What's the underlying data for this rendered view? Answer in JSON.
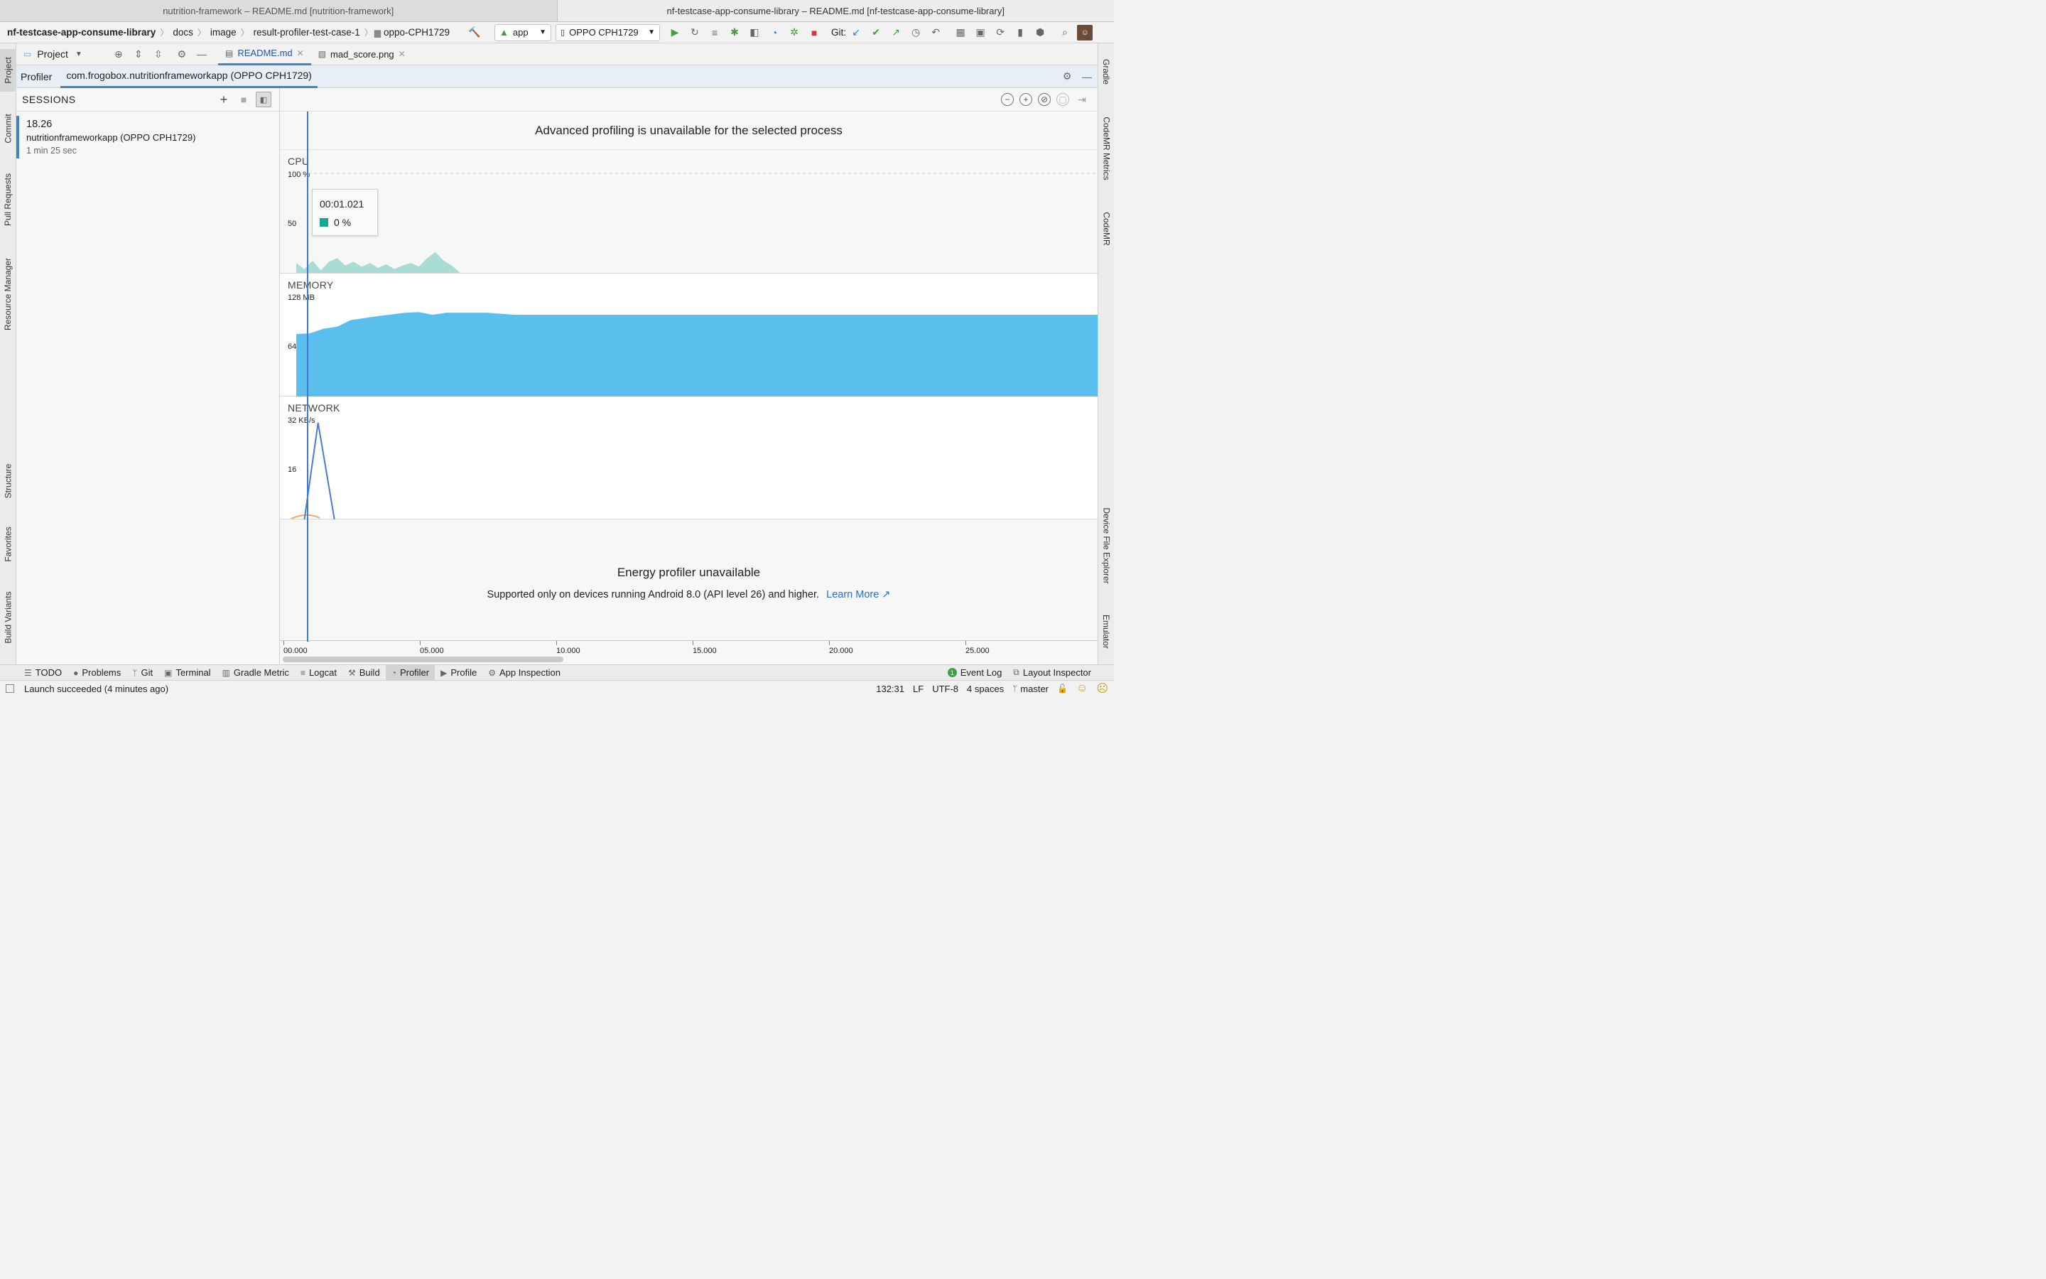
{
  "window_tabs": [
    {
      "label": "nutrition-framework – README.md [nutrition-framework]"
    },
    {
      "label": "nf-testcase-app-consume-library – README.md [nf-testcase-app-consume-library]"
    }
  ],
  "breadcrumbs": [
    "nf-testcase-app-consume-library",
    "docs",
    "image",
    "result-profiler-test-case-1",
    "oppo-CPH1729"
  ],
  "toolbar": {
    "run_config": "app",
    "device": "OPPO CPH1729",
    "git_label": "Git:"
  },
  "project_panel": {
    "title": "Project"
  },
  "editor_tabs": [
    {
      "label": "README.md",
      "active": true
    },
    {
      "label": "mad_score.png",
      "active": false
    }
  ],
  "left_tools": [
    "Project",
    "Commit",
    "Pull Requests",
    "Resource Manager",
    "Structure",
    "Favorites",
    "Build Variants"
  ],
  "right_tools": [
    "Gradle",
    "CodeMR Metrics",
    "CodeMR",
    "Device File Explorer",
    "Emulator"
  ],
  "profiler": {
    "tab_profiler": "Profiler",
    "tab_process": "com.frogobox.nutritionframeworkapp (OPPO CPH1729)",
    "sessions_title": "SESSIONS",
    "session": {
      "time": "18.26",
      "name": "nutritionframeworkapp (OPPO CPH1729)",
      "duration": "1 min 25 sec"
    },
    "advanced_msg": "Advanced profiling is unavailable for the selected process",
    "cpu": {
      "label": "CPU",
      "max": "100 %",
      "mid": "50"
    },
    "memory": {
      "label": "MEMORY",
      "max": "128 MB",
      "mid": "64"
    },
    "network": {
      "label": "NETWORK",
      "max": "32 KB/s",
      "mid": "16"
    },
    "tooltip": {
      "time": "00:01.021",
      "value": "0 %"
    },
    "energy_title": "Energy profiler unavailable",
    "energy_sub": "Supported only on devices running Android 8.0 (API level 26) and higher.",
    "learn_more": "Learn More ↗",
    "ticks": [
      "00.000",
      "05.000",
      "10.000",
      "15.000",
      "20.000",
      "25.000"
    ]
  },
  "chart_data": [
    {
      "type": "area",
      "title": "CPU",
      "x": [
        0.0,
        0.3,
        0.6,
        0.9,
        1.2,
        1.5,
        1.8,
        2.1,
        2.4,
        2.7,
        3.0,
        3.3,
        3.6,
        3.9,
        4.2,
        4.5,
        4.8,
        5.1,
        5.4,
        5.7,
        6.0
      ],
      "values": [
        8,
        3,
        10,
        2,
        9,
        12,
        6,
        9,
        5,
        8,
        4,
        7,
        3,
        6,
        8,
        5,
        12,
        17,
        10,
        6,
        0
      ],
      "ylim": [
        0,
        100
      ],
      "color": "#a9dcd4"
    },
    {
      "type": "area",
      "title": "MEMORY",
      "x": [
        0.0,
        0.5,
        1.0,
        1.5,
        2.0,
        3.0,
        4.0,
        4.5,
        5.0,
        5.5,
        6.0,
        7.0,
        8.0,
        10.0,
        15.0,
        20.0,
        25.0,
        29.5
      ],
      "values": [
        94,
        95,
        102,
        105,
        115,
        121,
        126,
        127,
        123,
        126,
        126,
        126,
        123,
        123,
        123,
        123,
        123,
        123
      ],
      "ylim": [
        0,
        185
      ],
      "color": "#5bbfed"
    },
    {
      "type": "line",
      "title": "NETWORK",
      "x": [
        0.3,
        0.8,
        1.4
      ],
      "values": [
        0,
        32,
        0
      ],
      "ylim": [
        0,
        32
      ],
      "color": "#4a7cd0"
    }
  ],
  "bottom_tools": [
    {
      "label": "TODO",
      "icon": "list-icon"
    },
    {
      "label": "Problems",
      "icon": "problems-icon"
    },
    {
      "label": "Git",
      "icon": "git-icon"
    },
    {
      "label": "Terminal",
      "icon": "terminal-icon"
    },
    {
      "label": "Gradle Metric",
      "icon": "gradle-icon"
    },
    {
      "label": "Logcat",
      "icon": "logcat-icon"
    },
    {
      "label": "Build",
      "icon": "hammer-icon"
    },
    {
      "label": "Profiler",
      "icon": "profiler-icon",
      "active": true
    },
    {
      "label": "Profile",
      "icon": "play-icon"
    },
    {
      "label": "App Inspection",
      "icon": "inspection-icon"
    }
  ],
  "bottom_right_tools": [
    {
      "label": "Event Log",
      "badge": "1"
    },
    {
      "label": "Layout Inspector"
    }
  ],
  "status": {
    "message": "Launch succeeded (4 minutes ago)",
    "position": "132:31",
    "line_sep": "LF",
    "encoding": "UTF-8",
    "indent": "4 spaces",
    "branch": "master"
  }
}
